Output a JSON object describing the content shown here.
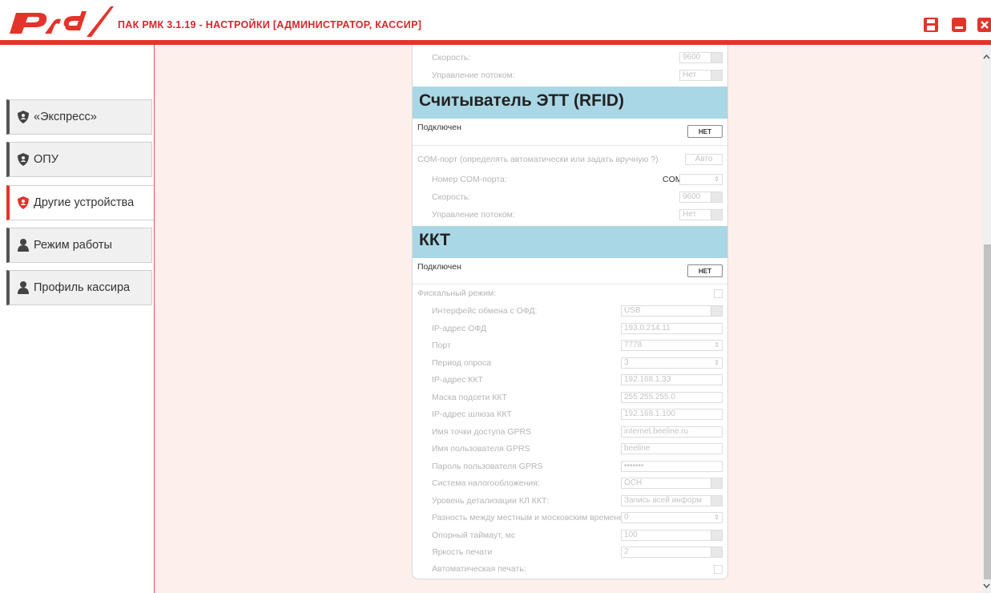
{
  "header": {
    "logo_text": "РЖД",
    "title": "ПАК РМК  3.1.19 - НАСТРОЙКИ [АДМИНИСТРАТОР, КАССИР]",
    "accent": "#e3342a"
  },
  "sidebar": {
    "items": [
      {
        "label": "«Экспресс»",
        "icon": "shield-icon",
        "active": false
      },
      {
        "label": "ОПУ",
        "icon": "shield-icon",
        "active": false
      },
      {
        "label": "Другие устройства",
        "icon": "shield-icon",
        "active": true
      },
      {
        "label": "Режим работы",
        "icon": "person-icon",
        "active": false
      },
      {
        "label": "Профиль кассира",
        "icon": "person-icon",
        "active": false
      }
    ]
  },
  "top_partial": {
    "speed_label": "Скорость:",
    "speed_value": "9600",
    "flow_label": "Управление потоком:",
    "flow_value": "Нет"
  },
  "rfid": {
    "title": "Считыватель ЭТТ (RFID)",
    "connected_label": "Подключен",
    "connected_toggle": "НЕТ",
    "com_label": "COM-порт (определять автоматически или задать вручную ?)",
    "com_button": "Авто",
    "port_label": "Номер COM-порта:",
    "port_prefix": "COM",
    "port_value": "",
    "speed_label": "Скорость:",
    "speed_value": "9600",
    "flow_label": "Управление потоком:",
    "flow_value": "Нет"
  },
  "kkt": {
    "title": "ККТ",
    "connected_label": "Подключен",
    "connected_toggle": "НЕТ",
    "fiscal_label": "Фискальный режим:",
    "fields": [
      {
        "label": "Интерфейс обмена с ОФД:",
        "value": "USB",
        "kind": "select"
      },
      {
        "label": "IP-адрес ОФД",
        "value": "193.0.214.11",
        "kind": "text"
      },
      {
        "label": "Порт",
        "value": "7778",
        "kind": "spin"
      },
      {
        "label": "Период опроса",
        "value": "3",
        "kind": "spin"
      },
      {
        "label": "IP-адрес ККТ",
        "value": "192.168.1.33",
        "kind": "text"
      },
      {
        "label": "Маска подсети ККТ",
        "value": "255.255.255.0",
        "kind": "text"
      },
      {
        "label": "IP-адрес шлюза ККТ",
        "value": "192.168.1.100",
        "kind": "text"
      },
      {
        "label": "Имя точки доступа GPRS",
        "value": "internet.beeline.ru",
        "kind": "text"
      },
      {
        "label": "Имя пользователя GPRS",
        "value": "beeline",
        "kind": "text"
      },
      {
        "label": "Пароль пользователя GPRS",
        "value": "•••••••",
        "kind": "text"
      },
      {
        "label": "Система налогообложения:",
        "value": "ОСН",
        "kind": "select"
      },
      {
        "label": "Уровень детализации КЛ ККТ:",
        "value": "Запись всей информ",
        "kind": "select"
      },
      {
        "label": "Разность между местным и московским временем (ч)",
        "value": "0",
        "kind": "spin"
      },
      {
        "label": "Опорный таймаут, мс",
        "value": "100",
        "kind": "select"
      },
      {
        "label": "Яркость печати",
        "value": "2",
        "kind": "select"
      }
    ],
    "auto_print_label": "Автоматическая печать:"
  }
}
